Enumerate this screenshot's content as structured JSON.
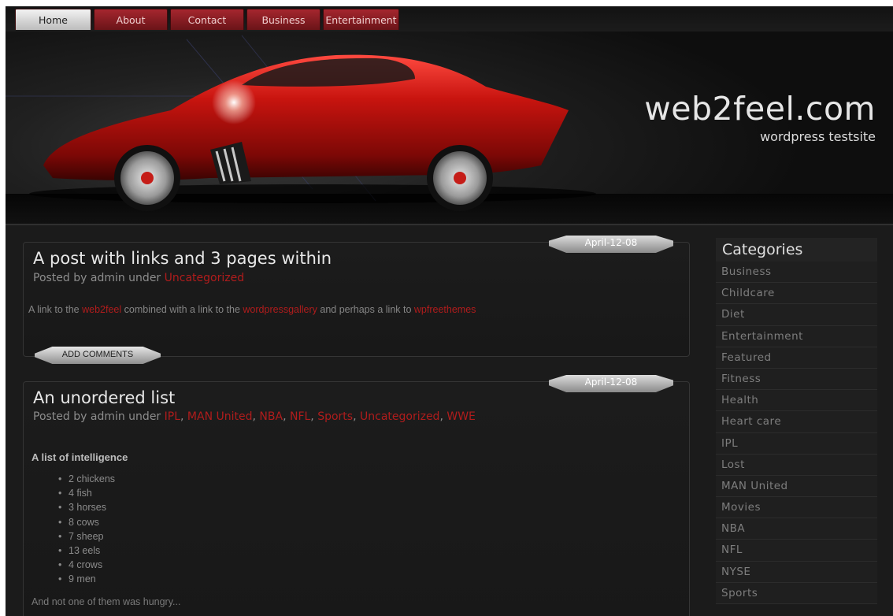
{
  "nav": {
    "tabs": [
      {
        "label": "Home",
        "active": true
      },
      {
        "label": "About",
        "active": false
      },
      {
        "label": "Contact",
        "active": false
      },
      {
        "label": "Business",
        "active": false
      },
      {
        "label": "Entertainment",
        "active": false
      }
    ]
  },
  "header": {
    "title": "web2feel.com",
    "tagline": "wordpress testsite"
  },
  "posts": [
    {
      "date": "April-12-08",
      "title": "A post with links and 3 pages within",
      "meta_prefix": "Posted by admin under ",
      "categories": [
        "Uncategorized"
      ],
      "body": {
        "t1": "A link to the ",
        "l1": "web2feel",
        "t2": " combined with a link to the ",
        "l2": "wordpressgallery",
        "t3": " and perhaps a link to ",
        "l3": "wpfreethemes"
      },
      "comments_label": "ADD COMMENTS"
    },
    {
      "date": "April-12-08",
      "title": "An unordered list",
      "meta_prefix": "Posted by admin under ",
      "categories": [
        "IPL",
        "MAN United",
        "NBA",
        "NFL",
        "Sports",
        "Uncategorized",
        "WWE"
      ],
      "list_heading": "A list of intelligence",
      "list_items": [
        "2 chickens",
        "4 fish",
        "3 horses",
        "8 cows",
        "7 sheep",
        "13 eels",
        "4 crows",
        "9 men"
      ],
      "outro": "And not one of them was hungry..."
    }
  ],
  "sidebar": {
    "title": "Categories",
    "items": [
      "Business",
      "Childcare",
      "Diet",
      "Entertainment",
      "Featured",
      "Fitness",
      "Health",
      "Heart care",
      "IPL",
      "Lost",
      "MAN United",
      "Movies",
      "NBA",
      "NFL",
      "NYSE",
      "Sports"
    ]
  },
  "colors": {
    "accent_red": "#b01c1c",
    "nav_red": "#8b1d22",
    "background": "#1b1b1b"
  },
  "icons": [
    "car-banner-image"
  ]
}
